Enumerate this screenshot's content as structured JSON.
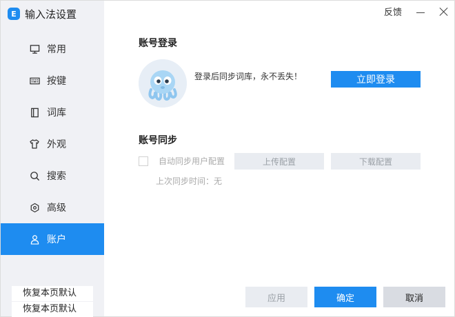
{
  "app": {
    "title": "输入法设置",
    "logo_text": "E"
  },
  "topbar": {
    "feedback": "反馈"
  },
  "sidebar": {
    "items": [
      {
        "label": "常用",
        "icon": "monitor-icon"
      },
      {
        "label": "按键",
        "icon": "keyboard-icon"
      },
      {
        "label": "词库",
        "icon": "book-icon"
      },
      {
        "label": "外观",
        "icon": "shirt-icon"
      },
      {
        "label": "搜索",
        "icon": "search-icon"
      },
      {
        "label": "高级",
        "icon": "hexagon-gear-icon"
      },
      {
        "label": "账户",
        "icon": "user-icon",
        "active": true
      }
    ],
    "restore_default": "恢复本页默认"
  },
  "account_login": {
    "title": "账号登录",
    "hint": "登录后同步词库，永不丢失！",
    "login_button": "立即登录"
  },
  "account_sync": {
    "title": "账号同步",
    "auto_sync_label": "自动同步用户配置",
    "auto_sync_checked": false,
    "upload_button": "上传配置",
    "download_button": "下载配置",
    "last_sync_label": "上次同步时间：",
    "last_sync_value": "无"
  },
  "footer": {
    "apply": "应用",
    "ok": "确定",
    "cancel": "取消"
  },
  "colors": {
    "accent": "#1e8cf0",
    "sidebar_bg": "#f0f1f5",
    "disabled_btn": "#e9ecf1"
  }
}
